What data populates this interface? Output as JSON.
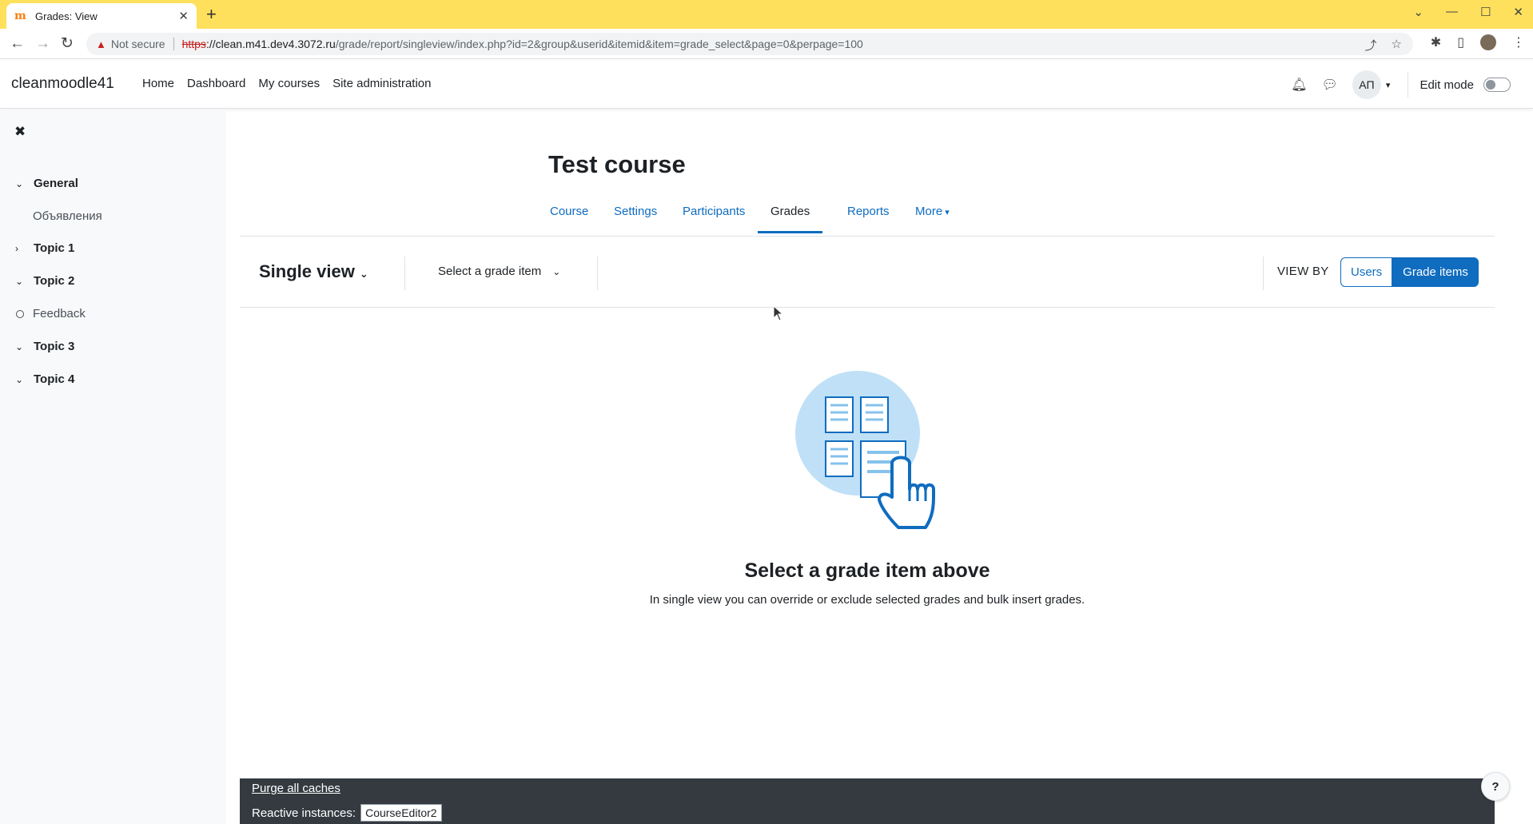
{
  "browser": {
    "tab_title": "Grades: View",
    "url_warning": "Not secure",
    "url_scheme": "https",
    "url_host": "://clean.m41.dev4.3072.ru",
    "url_rest": "/grade/report/singleview/index.php?id=2&group&userid&itemid&item=grade_select&page=0&perpage=100"
  },
  "navbar": {
    "brand": "cleanmoodle41",
    "items": [
      "Home",
      "Dashboard",
      "My courses",
      "Site administration"
    ],
    "user_initials": "АП",
    "edit_mode_label": "Edit mode"
  },
  "course_index": {
    "items": [
      {
        "label": "General",
        "type": "section",
        "state": "expanded"
      },
      {
        "label": "Объявления",
        "type": "activity"
      },
      {
        "label": "Topic 1",
        "type": "section",
        "state": "collapsed"
      },
      {
        "label": "Topic 2",
        "type": "section",
        "state": "expanded"
      },
      {
        "label": "Feedback",
        "type": "activity-circle"
      },
      {
        "label": "Topic 3",
        "type": "section",
        "state": "expanded"
      },
      {
        "label": "Topic 4",
        "type": "section",
        "state": "expanded"
      }
    ]
  },
  "page": {
    "course_title": "Test course",
    "secondary_nav": [
      "Course",
      "Settings",
      "Participants",
      "Grades",
      "Reports",
      "More"
    ],
    "active_tab": "Grades",
    "report_selector": "Single view",
    "grade_item_selector": "Select a grade item",
    "view_by_label": "VIEW BY",
    "view_by_options": [
      "Users",
      "Grade items"
    ],
    "view_by_active": "Grade items",
    "empty_title": "Select a grade item above",
    "empty_text": "In single view you can override or exclude selected grades and bulk insert grades."
  },
  "footer": {
    "purge_caches": "Purge all caches",
    "reactive_label": "Reactive instances:",
    "reactive_button": "CourseEditor2",
    "help": "?"
  },
  "colors": {
    "brand_blue": "#0f6cbf",
    "chrome_tabbar": "#fee05c",
    "footer_dark": "#343a40"
  }
}
